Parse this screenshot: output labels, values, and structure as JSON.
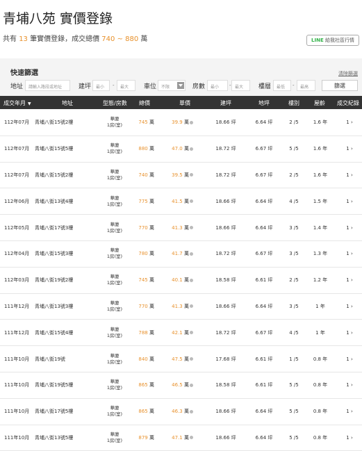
{
  "title": "青埔八苑 實價登錄",
  "summary": {
    "prefix": "共有",
    "count": "13",
    "mid": "筆實價登錄，成交總價",
    "range": "740 ~ 880",
    "unit": "萬"
  },
  "line_button": {
    "brand": "LINE",
    "label": "給我社區行情"
  },
  "filter": {
    "title": "快速篩選",
    "clear_label": "清除篩選",
    "address_label": "地址",
    "address_placeholder": "請輸入路段或地址",
    "ping_label": "建坪",
    "min_placeholder": "最小",
    "max_placeholder": "最大",
    "parking_label": "車位",
    "parking_value": "不限",
    "rooms_label": "房數",
    "floor_label": "樓層",
    "floor_min_placeholder": "最低",
    "floor_max_placeholder": "最高",
    "dash": "-",
    "search_label": "篩選"
  },
  "table": {
    "headers": {
      "date": "成交年月",
      "address": "地址",
      "type": "型態/房數",
      "price": "總價",
      "unit": "單價",
      "ping": "建坪",
      "land": "地坪",
      "floor": "樓別",
      "age": "屋齡",
      "records": "成交紀錄"
    },
    "rows": [
      {
        "date": "112年07月",
        "address": "青埔八街15號2樓",
        "type": "華廈",
        "rooms": "1房(室)",
        "price": "745",
        "unit": "39.9",
        "ping": "18.66",
        "land": "6.64",
        "floor": "2 /5",
        "age": "1.6 年",
        "records": "1"
      },
      {
        "date": "112年07月",
        "address": "青埔八街15號5樓",
        "type": "華廈",
        "rooms": "1房(室)",
        "price": "880",
        "unit": "47.0",
        "ping": "18.72",
        "land": "6.67",
        "floor": "5 /5",
        "age": "1.6 年",
        "records": "1"
      },
      {
        "date": "112年07月",
        "address": "青埔八街15號2樓",
        "type": "華廈",
        "rooms": "1房(室)",
        "price": "740",
        "unit": "39.5",
        "ping": "18.72",
        "land": "6.67",
        "floor": "2 /5",
        "age": "1.6 年",
        "records": "1"
      },
      {
        "date": "112年06月",
        "address": "青埔八街13號4樓",
        "type": "華廈",
        "rooms": "1房(室)",
        "price": "775",
        "unit": "41.5",
        "ping": "18.66",
        "land": "6.64",
        "floor": "4 /5",
        "age": "1.5 年",
        "records": "1"
      },
      {
        "date": "112年05月",
        "address": "青埔八街17號3樓",
        "type": "華廈",
        "rooms": "1房(室)",
        "price": "770",
        "unit": "41.3",
        "ping": "18.66",
        "land": "6.64",
        "floor": "3 /5",
        "age": "1.4 年",
        "records": "1"
      },
      {
        "date": "112年04月",
        "address": "青埔八街15號3樓",
        "type": "華廈",
        "rooms": "1房(室)",
        "price": "780",
        "unit": "41.7",
        "ping": "18.72",
        "land": "6.67",
        "floor": "3 /5",
        "age": "1.3 年",
        "records": "1"
      },
      {
        "date": "112年03月",
        "address": "青埔八街19號2樓",
        "type": "華廈",
        "rooms": "1房(室)",
        "price": "745",
        "unit": "40.1",
        "ping": "18.58",
        "land": "6.61",
        "floor": "2 /5",
        "age": "1.2 年",
        "records": "1"
      },
      {
        "date": "111年12月",
        "address": "青埔八街13號3樓",
        "type": "華廈",
        "rooms": "1房(室)",
        "price": "770",
        "unit": "41.3",
        "ping": "18.66",
        "land": "6.64",
        "floor": "3 /5",
        "age": "1 年",
        "records": "1"
      },
      {
        "date": "111年12月",
        "address": "青埔八街15號4樓",
        "type": "華廈",
        "rooms": "1房(室)",
        "price": "788",
        "unit": "42.1",
        "ping": "18.72",
        "land": "6.67",
        "floor": "4 /5",
        "age": "1 年",
        "records": "1"
      },
      {
        "date": "111年10月",
        "address": "青埔八街19號",
        "type": "華廈",
        "rooms": "1房(室)",
        "price": "840",
        "unit": "47.5",
        "ping": "17.68",
        "land": "6.61",
        "floor": "1 /5",
        "age": "0.8 年",
        "records": "1"
      },
      {
        "date": "111年10月",
        "address": "青埔八街19號5樓",
        "type": "華廈",
        "rooms": "1房(室)",
        "price": "865",
        "unit": "46.5",
        "ping": "18.58",
        "land": "6.61",
        "floor": "5 /5",
        "age": "0.8 年",
        "records": "1"
      },
      {
        "date": "111年10月",
        "address": "青埔八街17號5樓",
        "type": "華廈",
        "rooms": "1房(室)",
        "price": "865",
        "unit": "46.3",
        "ping": "18.66",
        "land": "6.64",
        "floor": "5 /5",
        "age": "0.8 年",
        "records": "1"
      },
      {
        "date": "111年10月",
        "address": "青埔八街13號5樓",
        "type": "華廈",
        "rooms": "1房(室)",
        "price": "879",
        "unit": "47.1",
        "ping": "18.66",
        "land": "6.64",
        "floor": "5 /5",
        "age": "0.8 年",
        "records": "1"
      }
    ],
    "price_unit": "萬",
    "unit_unit": "萬",
    "area_unit": "坪"
  },
  "colors": {
    "accent": "#e8912c",
    "header_bg": "#333333",
    "line_green": "#34b34a"
  }
}
